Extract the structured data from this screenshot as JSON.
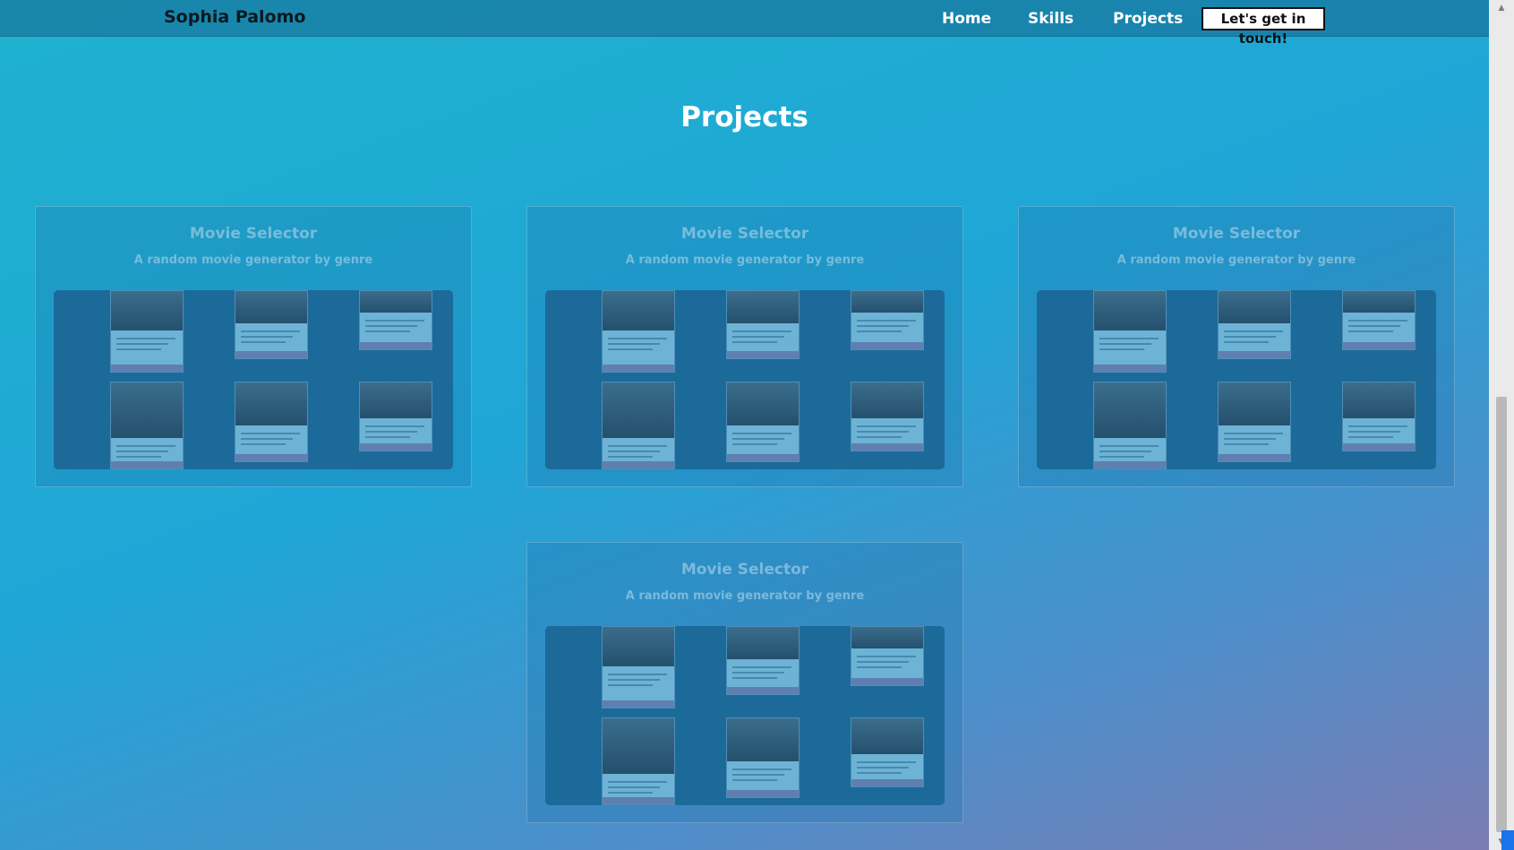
{
  "nav": {
    "brand": "Sophia Palomo",
    "links": [
      {
        "label": "Home"
      },
      {
        "label": "Skills"
      },
      {
        "label": "Projects"
      }
    ],
    "cta": "Let's get in touch!"
  },
  "main": {
    "title": "Projects",
    "projects": [
      {
        "title": "Movie Selector",
        "subtitle": "A random movie generator by genre"
      },
      {
        "title": "Movie Selector",
        "subtitle": "A random movie generator by genre"
      },
      {
        "title": "Movie Selector",
        "subtitle": "A random movie generator by genre"
      },
      {
        "title": "Movie Selector",
        "subtitle": "A random movie generator by genre"
      }
    ]
  },
  "colors": {
    "accent": "#1fa6d6",
    "cta_bg": "#ffffff"
  }
}
